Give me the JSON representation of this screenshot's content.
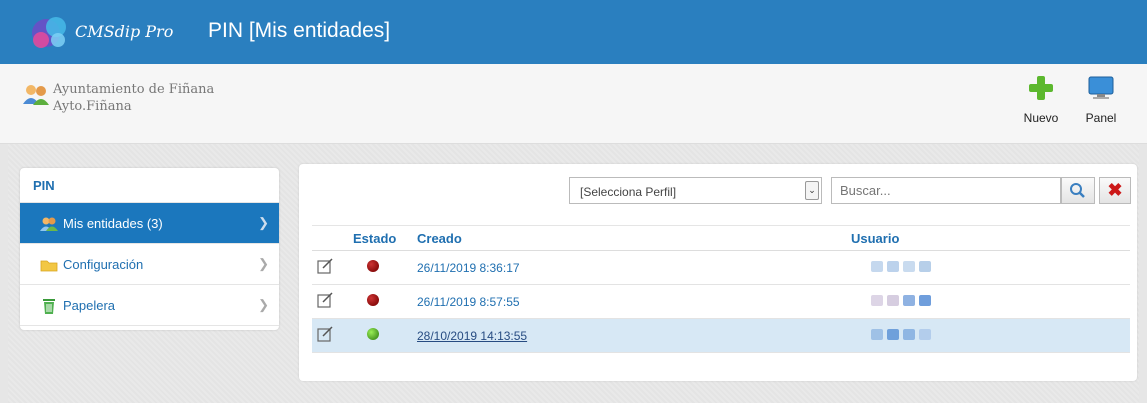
{
  "app": {
    "brand": "CMSdip Pro",
    "title": "PIN [Mis entidades]"
  },
  "header": {
    "org_name": "Ayuntamiento de Fiñana",
    "org_short": "Ayto.Fiñana",
    "buttons": [
      {
        "label": "Nuevo",
        "icon": "plus-icon"
      },
      {
        "label": "Panel",
        "icon": "monitor-icon"
      }
    ]
  },
  "sidebar": {
    "title": "PIN",
    "items": [
      {
        "label": "Mis entidades (3)",
        "icon": "users-icon",
        "active": true
      },
      {
        "label": "Configuración",
        "icon": "folder-icon",
        "active": false
      },
      {
        "label": "Papelera",
        "icon": "trash-icon",
        "active": false
      }
    ]
  },
  "toolbar": {
    "profile_select": "[Selecciona Perfil]",
    "search_placeholder": "Buscar..."
  },
  "table": {
    "headers": {
      "estado": "Estado",
      "creado": "Creado",
      "usuario": "Usuario"
    },
    "rows": [
      {
        "estado": "red",
        "creado": "26/11/2019 8:36:17",
        "usuario_redacted": true
      },
      {
        "estado": "red",
        "creado": "26/11/2019 8:57:55",
        "usuario_redacted": true
      },
      {
        "estado": "green",
        "creado": "28/10/2019 14:13:55",
        "usuario_redacted": true
      }
    ]
  },
  "colors": {
    "topbar": "#2a7fbf",
    "accent": "#1b77bd",
    "status_red": "#8a0c0c",
    "status_green": "#4a9a22"
  }
}
